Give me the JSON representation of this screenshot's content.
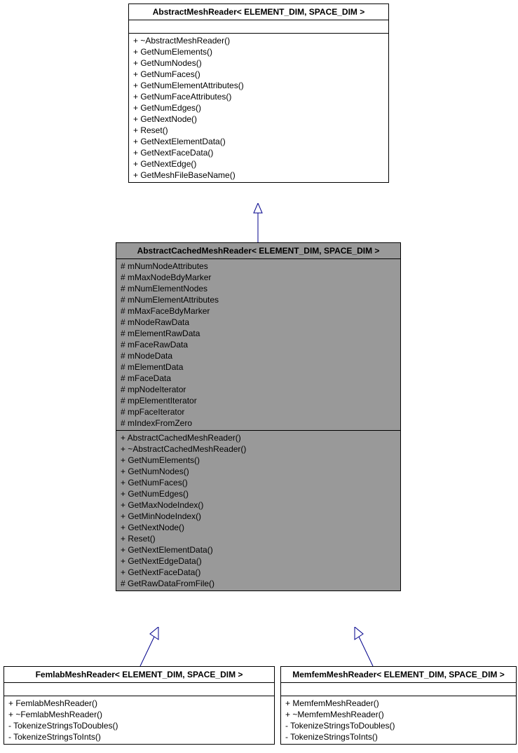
{
  "classes": {
    "abstractMeshReader": {
      "title": "AbstractMeshReader< ELEMENT_DIM, SPACE_DIM >",
      "methods": [
        "+ ~AbstractMeshReader()",
        "+ GetNumElements()",
        "+ GetNumNodes()",
        "+ GetNumFaces()",
        "+ GetNumElementAttributes()",
        "+ GetNumFaceAttributes()",
        "+ GetNumEdges()",
        "+ GetNextNode()",
        "+ Reset()",
        "+ GetNextElementData()",
        "+ GetNextFaceData()",
        "+ GetNextEdge()",
        "+ GetMeshFileBaseName()"
      ]
    },
    "abstractCachedMeshReader": {
      "title": "AbstractCachedMeshReader< ELEMENT_DIM, SPACE_DIM >",
      "attributes": [
        "# mNumNodeAttributes",
        "# mMaxNodeBdyMarker",
        "# mNumElementNodes",
        "# mNumElementAttributes",
        "# mMaxFaceBdyMarker",
        "# mNodeRawData",
        "# mElementRawData",
        "# mFaceRawData",
        "# mNodeData",
        "# mElementData",
        "# mFaceData",
        "# mpNodeIterator",
        "# mpElementIterator",
        "# mpFaceIterator",
        "# mIndexFromZero"
      ],
      "methods": [
        "+ AbstractCachedMeshReader()",
        "+ ~AbstractCachedMeshReader()",
        "+ GetNumElements()",
        "+ GetNumNodes()",
        "+ GetNumFaces()",
        "+ GetNumEdges()",
        "+ GetMaxNodeIndex()",
        "+ GetMinNodeIndex()",
        "+ GetNextNode()",
        "+ Reset()",
        "+ GetNextElementData()",
        "+ GetNextEdgeData()",
        "+ GetNextFaceData()",
        "# GetRawDataFromFile()"
      ]
    },
    "femlabMeshReader": {
      "title": "FemlabMeshReader< ELEMENT_DIM, SPACE_DIM >",
      "methods": [
        "+ FemlabMeshReader()",
        "+ ~FemlabMeshReader()",
        "- TokenizeStringsToDoubles()",
        "- TokenizeStringsToInts()"
      ]
    },
    "memfemMeshReader": {
      "title": "MemfemMeshReader< ELEMENT_DIM, SPACE_DIM >",
      "methods": [
        "+ MemfemMeshReader()",
        "+ ~MemfemMeshReader()",
        "- TokenizeStringsToDoubles()",
        "- TokenizeStringsToInts()"
      ]
    }
  }
}
